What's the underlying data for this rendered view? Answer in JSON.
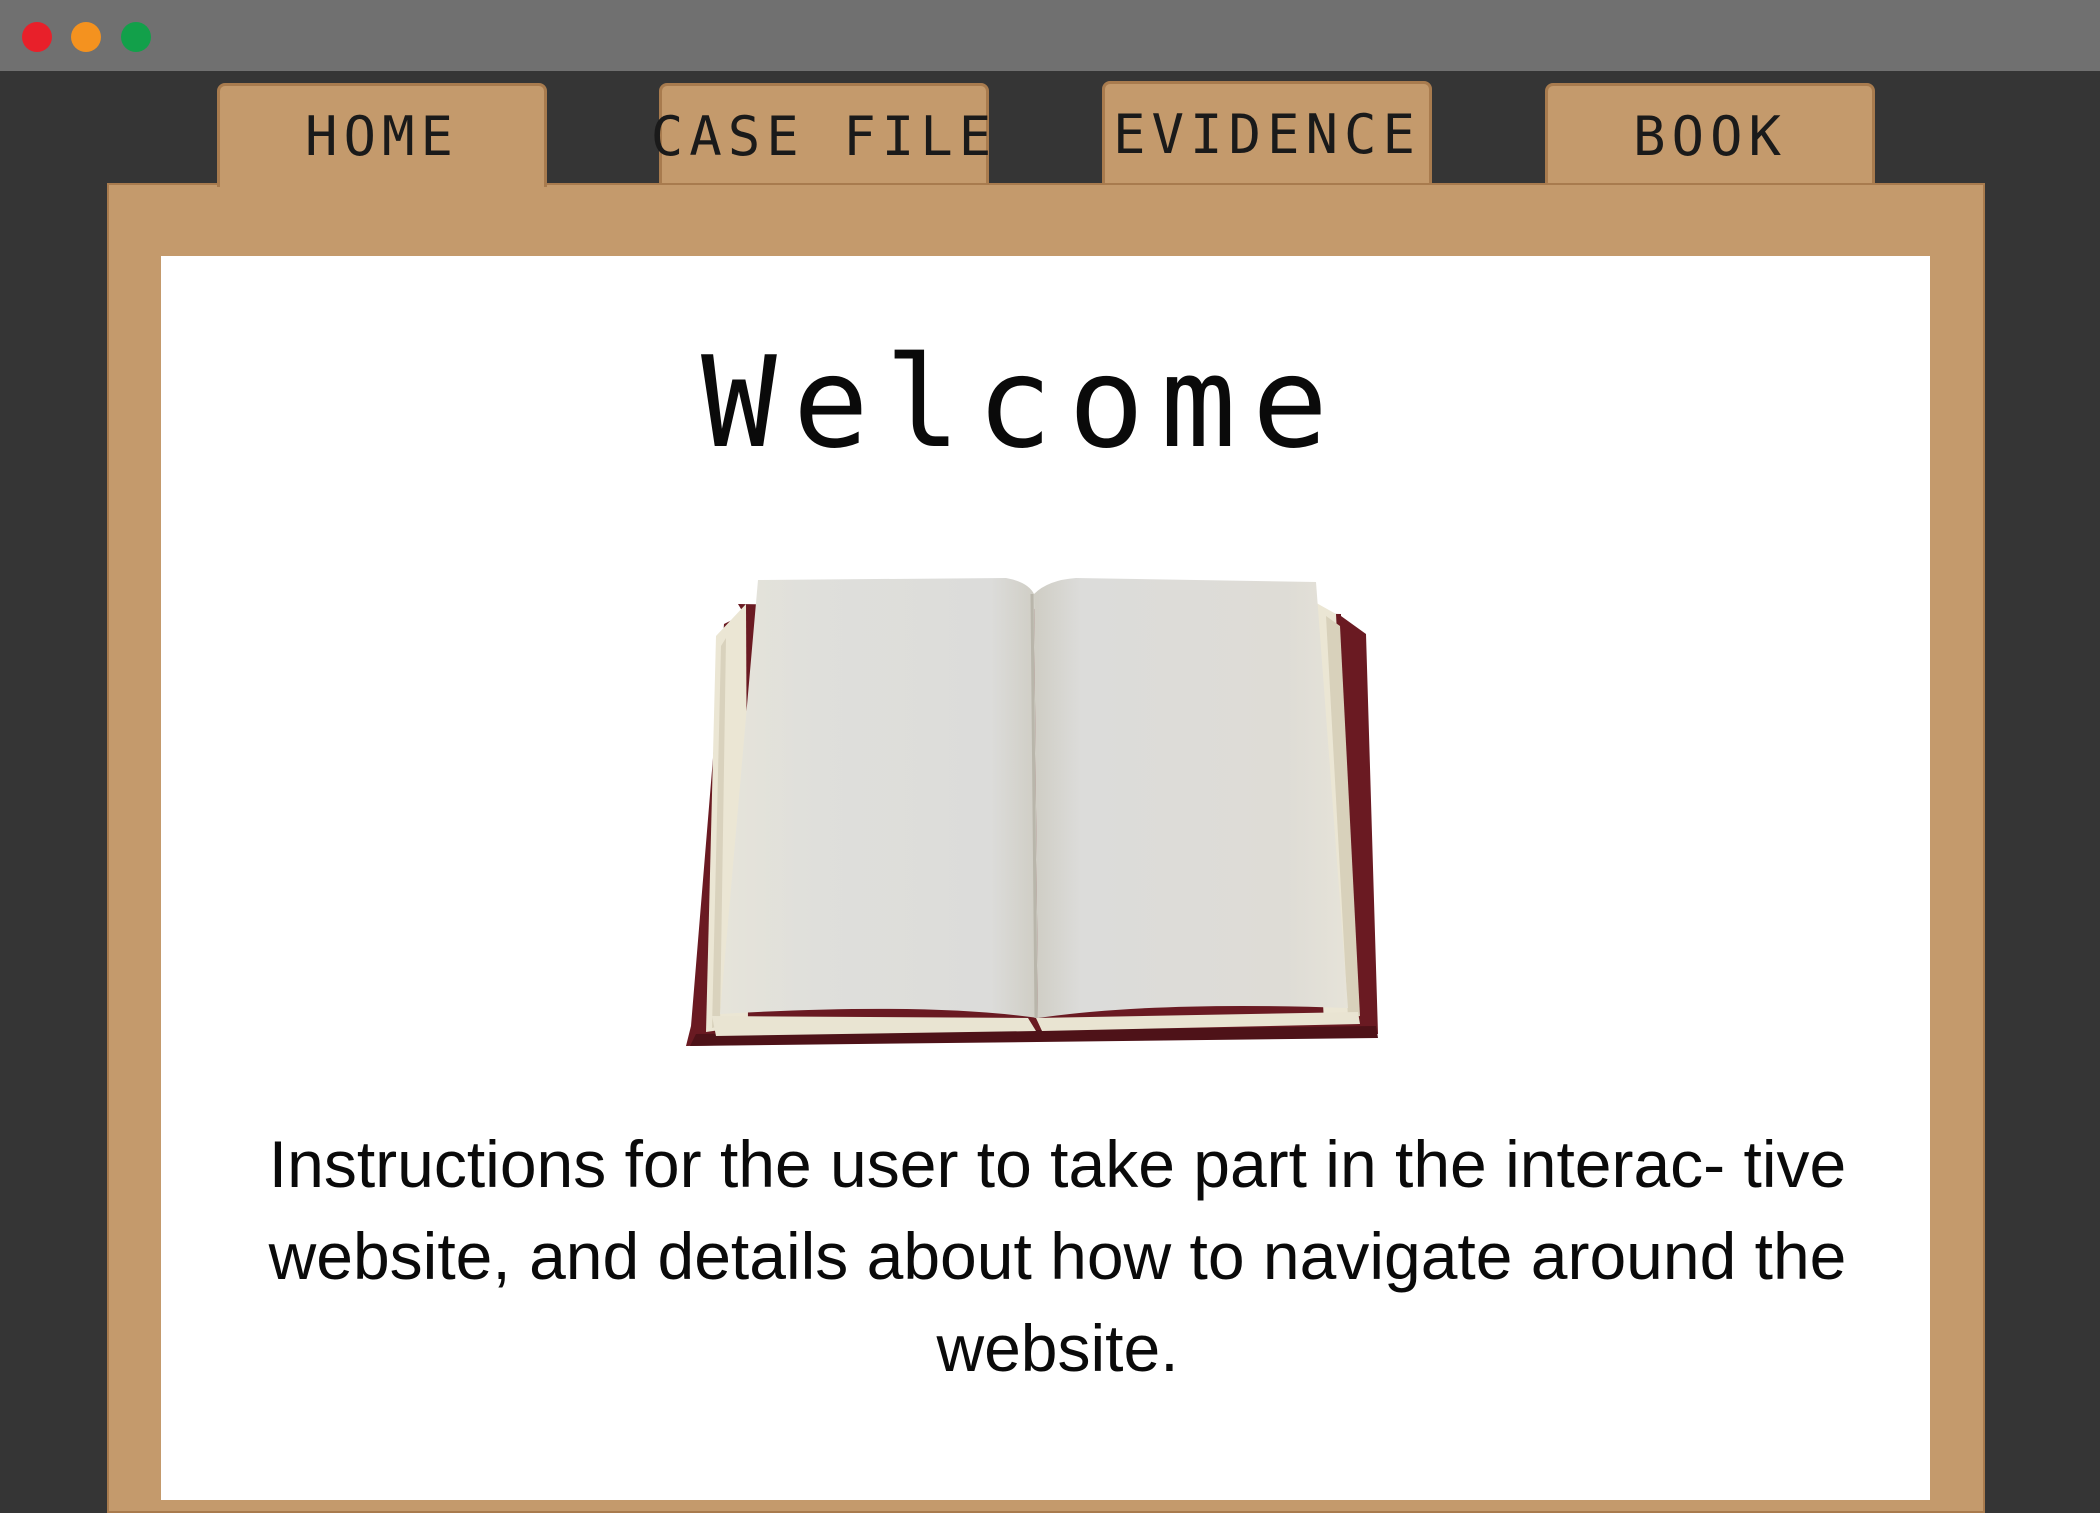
{
  "window": {
    "controls": [
      "close",
      "minimize",
      "maximize"
    ]
  },
  "tabs": [
    {
      "label": "HOME",
      "active": true
    },
    {
      "label": "CASE FILE",
      "active": false
    },
    {
      "label": "EVIDENCE",
      "active": false
    },
    {
      "label": "BOOK",
      "active": false
    }
  ],
  "main": {
    "heading": "Welcome",
    "image": "open-book",
    "instructions": "Instructions for the user to take part in the interac- tive website, and details about how to navigate around the website."
  },
  "colors": {
    "background": "#353535",
    "titlebar": "#707070",
    "folder": "#c49a6c",
    "folder_border": "#a87b4e",
    "sheet": "#ffffff",
    "close": "#e8202a",
    "minimize": "#f4921f",
    "maximize": "#12a04a"
  }
}
